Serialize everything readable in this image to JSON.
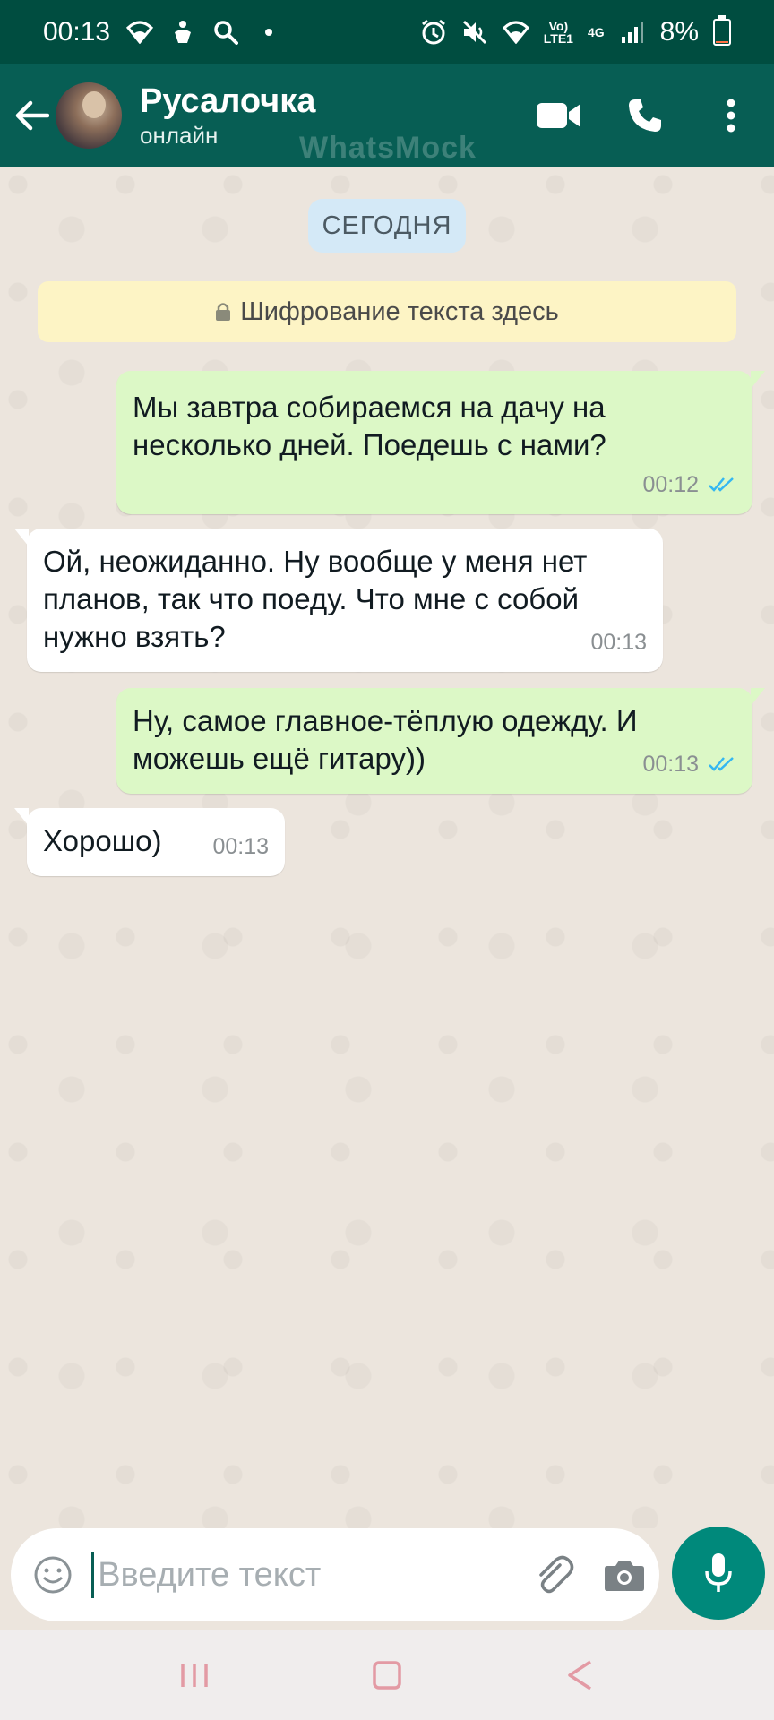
{
  "status_bar": {
    "time": "00:13",
    "network_label": "Vo)\nLTE1",
    "network_type": "4G",
    "battery_percent": "8%",
    "battery_level": 0.08,
    "battery_color": "#ff7043",
    "icons": [
      "wifi-icon",
      "accessibility-icon",
      "search-icon",
      "dot-icon",
      "alarm-icon",
      "mute-icon",
      "wifi-icon",
      "signal-icon",
      "battery-icon"
    ]
  },
  "header": {
    "contact_name": "Русалочка",
    "contact_status": "онлайн",
    "watermark": "WhatsMock",
    "bg_color": "#075e54",
    "icons": [
      "back-arrow-icon",
      "video-call-icon",
      "phone-icon",
      "more-vert-icon"
    ]
  },
  "chat": {
    "date_label": "СЕГОДНЯ",
    "encryption_notice": "Шифрование текста здесь",
    "messages": [
      {
        "direction": "out",
        "text": "Мы завтра собираемся на дачу на несколько дней. Поедешь с нами?",
        "time": "00:12",
        "status": "read"
      },
      {
        "direction": "in",
        "text": "Ой, неожиданно. Ну вообще у меня нет планов, так что поеду. Что мне с собой нужно взять?",
        "time": "00:13"
      },
      {
        "direction": "out",
        "text": "Ну, самое главное-тёплую одежду. И можешь ещё гитару))",
        "time": "00:13",
        "status": "read"
      },
      {
        "direction": "in",
        "text": "Хорошо)",
        "time": "00:13"
      }
    ]
  },
  "input_bar": {
    "placeholder": "Введите текст",
    "value": ""
  },
  "colors": {
    "outgoing_bubble": "#dcf8c6",
    "incoming_bubble": "#ffffff",
    "read_ticks": "#34b7f1",
    "mic_button": "#00897b"
  }
}
